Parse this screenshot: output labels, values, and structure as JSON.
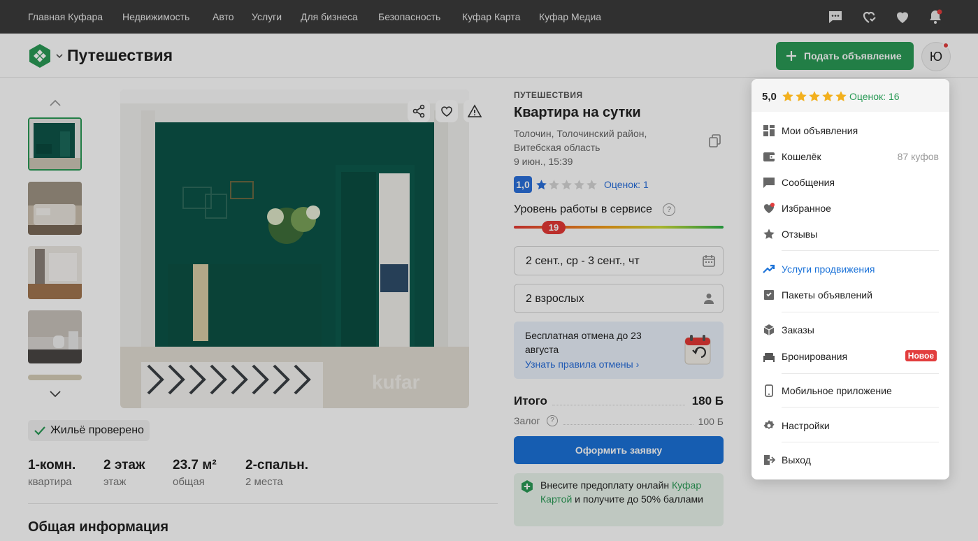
{
  "topnav": {
    "links": [
      "Главная Куфара",
      "Недвижимость",
      "Авто",
      "Услуги",
      "Для бизнеса",
      "Безопасность",
      "Куфар Карта",
      "Куфар Медиа"
    ],
    "icons": [
      "chat-icon",
      "heart-check-icon",
      "heart-icon",
      "bell-icon"
    ]
  },
  "header": {
    "section_title": "Путешествия",
    "post_button": "Подать объявление",
    "avatar_letter": "Ю",
    "brand_color": "#2a9a56"
  },
  "gallery": {
    "photo_count_visible": 5,
    "verified_label": "Жильё проверено",
    "watermark": "kufar"
  },
  "features": [
    {
      "value": "1-комн.",
      "label": "квартира"
    },
    {
      "value": "2 этаж",
      "label": "этаж"
    },
    {
      "value": "23.7 м²",
      "label": "общая"
    },
    {
      "value": "2-спальн.",
      "label": "2 места"
    }
  ],
  "general_info_title": "Общая информация",
  "listing": {
    "category": "ПУТЕШЕСТВИЯ",
    "title": "Квартира на сутки",
    "address_line1": "Толочин, Толочинский район,",
    "address_line2": "Витебская область",
    "date": "9 июн., 15:39",
    "rating": "1,0",
    "rating_stars": 1,
    "rating_count": "Оценок: 1",
    "service_level_label": "Уровень работы в сервисе",
    "service_level_value": "19",
    "dates_field": "2 сент., ср - 3 сент., чт",
    "guests_field": "2 взрослых",
    "cancel_text": "Бесплатная отмена до 23 августа",
    "cancel_link": "Узнать правила отмены ›",
    "total_label": "Итого",
    "total_value": "180 Б",
    "deposit_label": "Залог",
    "deposit_value": "100 Б",
    "order_button": "Оформить заявку",
    "promo_text_a": "Внесите предоплату онлайн",
    "promo_link": "Куфар Картой",
    "promo_text_b": "и получите до 50% баллами"
  },
  "user_menu": {
    "score": "5,0",
    "stars": 5,
    "reviews": "Оценок: 16",
    "items": [
      {
        "label": "Мои объявления",
        "icon": "grid-icon"
      },
      {
        "label": "Кошелёк",
        "icon": "wallet-icon",
        "right": "87 куфов"
      },
      {
        "label": "Сообщения",
        "icon": "message-icon"
      },
      {
        "label": "Избранное",
        "icon": "heart-icon"
      },
      {
        "label": "Отзывы",
        "icon": "star-icon"
      },
      {
        "label": "Услуги продвижения",
        "icon": "trending-icon",
        "accent": "#1b72d8"
      },
      {
        "label": "Пакеты объявлений",
        "icon": "package-icon"
      },
      {
        "label": "Заказы",
        "icon": "box-icon"
      },
      {
        "label": "Бронирования",
        "icon": "bed-icon",
        "badge": "Новое"
      },
      {
        "label": "Мобильное приложение",
        "icon": "phone-icon"
      },
      {
        "label": "Настройки",
        "icon": "gear-icon"
      },
      {
        "label": "Выход",
        "icon": "logout-icon"
      }
    ]
  }
}
